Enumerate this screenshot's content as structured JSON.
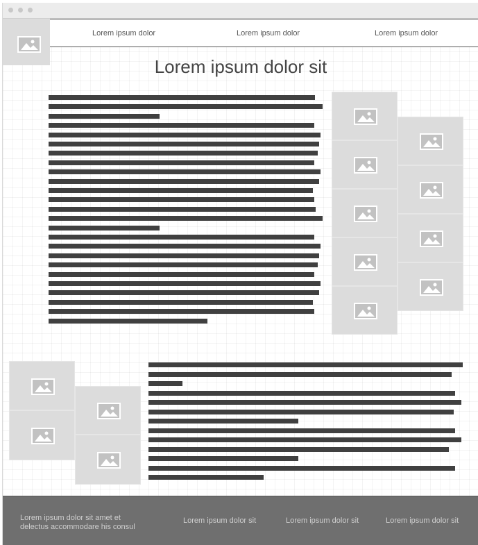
{
  "nav": {
    "logo_icon": "image-placeholder-icon",
    "links": [
      "Lorem ipsum dolor",
      "Lorem ipsum dolor",
      "Lorem ipsum dolor"
    ]
  },
  "page": {
    "title": "Lorem ipsum dolor sit"
  },
  "footer": {
    "about_line1": "Lorem ipsum dolor sit amet et",
    "about_line2": "delectus accommodare his consul",
    "links": [
      "Lorem ipsum dolor sit",
      "Lorem ipsum dolor sit",
      "Lorem ipsum dolor sit"
    ]
  },
  "colors": {
    "text_bar": "#404040",
    "image_placeholder": "#dcdcdc",
    "footer_bg": "#6f6f6f"
  }
}
